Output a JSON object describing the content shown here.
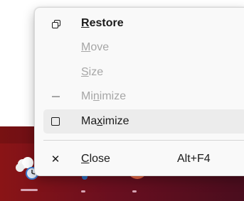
{
  "context_menu": {
    "items": [
      {
        "id": "restore",
        "label": "Restore",
        "mnemonic": "R",
        "icon": "restore-icon",
        "enabled": true,
        "bold": true
      },
      {
        "id": "move",
        "label": "Move",
        "mnemonic": "M",
        "icon": "",
        "enabled": false
      },
      {
        "id": "size",
        "label": "Size",
        "mnemonic": "S",
        "icon": "",
        "enabled": false
      },
      {
        "id": "minimize",
        "label": "Minimize",
        "mnemonic": "n",
        "icon": "minimize-icon",
        "enabled": false
      },
      {
        "id": "maximize",
        "label": "Maximize",
        "mnemonic": "x",
        "icon": "maximize-icon",
        "enabled": true,
        "hover": true
      },
      {
        "id": "close",
        "label": "Close",
        "mnemonic": "C",
        "icon": "close-icon",
        "enabled": true,
        "accelerator": "Alt+F4"
      }
    ]
  },
  "taskbar": {
    "apps": [
      {
        "icon": "weather-clock-app-icon",
        "active": true
      },
      {
        "icon": "network-app-icon",
        "active": false
      },
      {
        "icon": "powerpoint-app-icon",
        "active": false
      }
    ],
    "colors": {
      "taskbar": "#7a1020",
      "indicator_active": "#d7a5b4"
    }
  },
  "glyphs": {
    "close": "✕"
  }
}
